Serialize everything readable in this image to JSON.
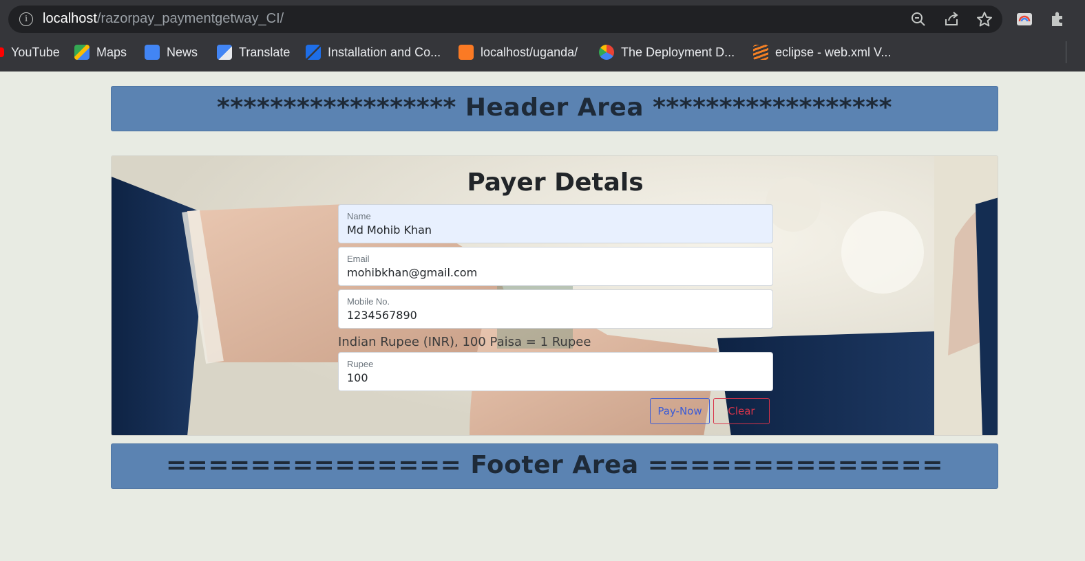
{
  "browser": {
    "url_host": "localhost",
    "url_path": "/razorpay_paymentgetway_CI/",
    "bookmarks": [
      {
        "label": "YouTube",
        "icon": "youtube-icon",
        "color": "#ff0000"
      },
      {
        "label": "Maps",
        "icon": "maps-icon",
        "color": "#34a853"
      },
      {
        "label": "News",
        "icon": "news-icon",
        "color": "#4285f4"
      },
      {
        "label": "Translate",
        "icon": "translate-icon",
        "color": "#4285f4"
      },
      {
        "label": "Installation and Co...",
        "icon": "zend-icon",
        "color": "#1e6ee8"
      },
      {
        "label": "localhost/uganda/",
        "icon": "xampp-icon",
        "color": "#fb7a24"
      },
      {
        "label": "The Deployment D...",
        "icon": "google-cloud-icon",
        "color": "#ea4335"
      },
      {
        "label": "eclipse - web.xml V...",
        "icon": "stackoverflow-icon",
        "color": "#f48024"
      }
    ]
  },
  "header": {
    "text": "****************** Header Area ******************"
  },
  "form": {
    "title": "Payer Detals",
    "name": {
      "label": "Name",
      "value": "Md Mohib Khan"
    },
    "email": {
      "label": "Email",
      "value": "mohibkhan@gmail.com"
    },
    "mobile": {
      "label": "Mobile No.",
      "value": "1234567890"
    },
    "currency_note": "Indian Rupee (INR), 100 Paisa = 1 Rupee",
    "rupee": {
      "label": "Rupee",
      "value": "100"
    },
    "pay_label": "Pay-Now",
    "clear_label": "Clear"
  },
  "footer": {
    "text": "============== Footer Area =============="
  },
  "colors": {
    "header_bg": "#5b83b2",
    "pay": "#3a5bd6",
    "clear": "#d8344a",
    "page_bg": "#e8ebe3"
  }
}
